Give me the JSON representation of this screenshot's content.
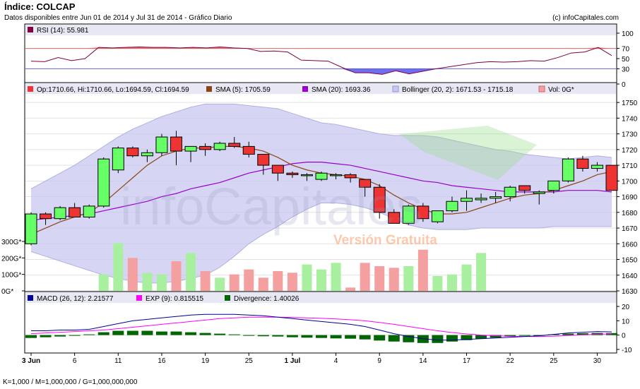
{
  "header": {
    "title": "Índice: COLCAP",
    "subtitle": "Datos disponibles entre Jun 01 de 2014 y Jul 31 de 2014 - Gráfico Diario",
    "copyright": "(c) infoCapitales.com"
  },
  "footer": "K=1,000 / M=1,000,000 / G=1,000,000,000",
  "watermark": {
    "brand": "infoCapitales",
    "version": "Versión Gratuita"
  },
  "colors": {
    "up": "#66ff66",
    "down": "#ee3333",
    "sma5": "#8b4513",
    "sma20": "#9900cc",
    "bollinger": "#c8c8f0",
    "vol_up": "#a8f0a0",
    "vol_down": "#f5a0a0",
    "rsi": "#800040",
    "macd": "#000099",
    "exp": "#ff00ff",
    "divergence": "#006600"
  },
  "chart_data": [
    {
      "panel": "rsi",
      "type": "line",
      "legend": "RSI (14): 55.981",
      "yticks": [
        "100",
        "70",
        "50",
        "30",
        "0"
      ],
      "ylim": [
        0,
        100
      ],
      "levels": [
        70,
        30
      ],
      "values": [
        45,
        44,
        52,
        46,
        50,
        72,
        71,
        72,
        73,
        72,
        72,
        71,
        72,
        71,
        73,
        71,
        70,
        64,
        65,
        63,
        47,
        46,
        45,
        33,
        22,
        22,
        19,
        26,
        20,
        25,
        30,
        34,
        38,
        42,
        44,
        43,
        44,
        46,
        45,
        52,
        61,
        63,
        72,
        56
      ]
    },
    {
      "panel": "price",
      "type": "candlestick",
      "legend": {
        "ohlc": "Op:1710.66, Hi:1710.66, Lo:1694.59, Cl:1694.59",
        "sma5": "SMA (5): 1705.59",
        "sma20": "SMA (20): 1693.36",
        "bollinger": "Bollinger (20, 2): 1671.53 - 1715.18",
        "volume": "Vol: 0G*"
      },
      "yticks": [
        "1750",
        "1740",
        "1730",
        "1720",
        "1710",
        "1700",
        "1690",
        "1680",
        "1670",
        "1660",
        "1650",
        "1640",
        "1630"
      ],
      "ylim": [
        1630,
        1755
      ],
      "volume_ticks": [
        "300G*",
        "200G*",
        "100G*",
        "0G*"
      ],
      "volume_max": 300,
      "xticks": [
        {
          "index": 0,
          "label": "3 Jun"
        },
        {
          "index": 3,
          "label": "6"
        },
        {
          "index": 6,
          "label": "11"
        },
        {
          "index": 9,
          "label": "16"
        },
        {
          "index": 12,
          "label": "19"
        },
        {
          "index": 15,
          "label": "25"
        },
        {
          "index": 18,
          "label": "1 Jul"
        },
        {
          "index": 21,
          "label": "4"
        },
        {
          "index": 24,
          "label": "9"
        },
        {
          "index": 27,
          "label": "14"
        },
        {
          "index": 30,
          "label": "17"
        },
        {
          "index": 33,
          "label": "22"
        },
        {
          "index": 36,
          "label": "25"
        },
        {
          "index": 39,
          "label": "30"
        }
      ],
      "candles": [
        {
          "o": 1660,
          "h": 1680,
          "l": 1659,
          "c": 1679,
          "v": 0
        },
        {
          "o": 1679,
          "h": 1680,
          "l": 1672,
          "c": 1676,
          "v": 0
        },
        {
          "o": 1676,
          "h": 1684,
          "l": 1675,
          "c": 1683,
          "v": 0
        },
        {
          "o": 1683,
          "h": 1686,
          "l": 1677,
          "c": 1677,
          "v": 0
        },
        {
          "o": 1677,
          "h": 1685,
          "l": 1676,
          "c": 1684,
          "v": 0
        },
        {
          "o": 1684,
          "h": 1715,
          "l": 1683,
          "c": 1714,
          "v": 100
        },
        {
          "o": 1707,
          "h": 1722,
          "l": 1705,
          "c": 1721,
          "v": 290
        },
        {
          "o": 1721,
          "h": 1722,
          "l": 1715,
          "c": 1716,
          "v": 200
        },
        {
          "o": 1716,
          "h": 1720,
          "l": 1712,
          "c": 1718,
          "v": 110
        },
        {
          "o": 1718,
          "h": 1730,
          "l": 1716,
          "c": 1728,
          "v": 100
        },
        {
          "o": 1728,
          "h": 1732,
          "l": 1710,
          "c": 1719,
          "v": 180
        },
        {
          "o": 1719,
          "h": 1722,
          "l": 1712,
          "c": 1722,
          "v": 230
        },
        {
          "o": 1722,
          "h": 1724,
          "l": 1716,
          "c": 1720,
          "v": 120
        },
        {
          "o": 1720,
          "h": 1725,
          "l": 1719,
          "c": 1724,
          "v": 80
        },
        {
          "o": 1724,
          "h": 1728,
          "l": 1721,
          "c": 1722,
          "v": 100
        },
        {
          "o": 1722,
          "h": 1725,
          "l": 1715,
          "c": 1717,
          "v": 130
        },
        {
          "o": 1717,
          "h": 1717,
          "l": 1704,
          "c": 1710,
          "v": 80
        },
        {
          "o": 1710,
          "h": 1710,
          "l": 1700,
          "c": 1705,
          "v": 120
        },
        {
          "o": 1705,
          "h": 1706,
          "l": 1702,
          "c": 1704,
          "v": 110
        },
        {
          "o": 1704,
          "h": 1705,
          "l": 1700,
          "c": 1704,
          "v": 160
        },
        {
          "o": 1701,
          "h": 1706,
          "l": 1700,
          "c": 1705,
          "v": 130
        },
        {
          "o": 1704,
          "h": 1705,
          "l": 1701,
          "c": 1704,
          "v": 170
        },
        {
          "o": 1704,
          "h": 1705,
          "l": 1699,
          "c": 1702,
          "v": 20
        },
        {
          "o": 1701,
          "h": 1701,
          "l": 1690,
          "c": 1696,
          "v": 170
        },
        {
          "o": 1696,
          "h": 1698,
          "l": 1676,
          "c": 1680,
          "v": 150
        },
        {
          "o": 1680,
          "h": 1682,
          "l": 1673,
          "c": 1673,
          "v": 140
        },
        {
          "o": 1673,
          "h": 1685,
          "l": 1672,
          "c": 1684,
          "v": 150
        },
        {
          "o": 1684,
          "h": 1686,
          "l": 1674,
          "c": 1676,
          "v": 250
        },
        {
          "o": 1674,
          "h": 1681,
          "l": 1673,
          "c": 1681,
          "v": 90
        },
        {
          "o": 1681,
          "h": 1690,
          "l": 1680,
          "c": 1687,
          "v": 100
        },
        {
          "o": 1687,
          "h": 1694,
          "l": 1681,
          "c": 1689,
          "v": 160
        },
        {
          "o": 1688,
          "h": 1692,
          "l": 1686,
          "c": 1689,
          "v": 230
        },
        {
          "o": 1689,
          "h": 1693,
          "l": 1686,
          "c": 1690,
          "v": 0
        },
        {
          "o": 1690,
          "h": 1697,
          "l": 1687,
          "c": 1696,
          "v": 0
        },
        {
          "o": 1697,
          "h": 1697,
          "l": 1692,
          "c": 1694,
          "v": 0
        },
        {
          "o": 1692,
          "h": 1694,
          "l": 1685,
          "c": 1693,
          "v": 0
        },
        {
          "o": 1694,
          "h": 1700,
          "l": 1692,
          "c": 1700,
          "v": 0
        },
        {
          "o": 1700,
          "h": 1715,
          "l": 1699,
          "c": 1714,
          "v": 0
        },
        {
          "o": 1714,
          "h": 1716,
          "l": 1706,
          "c": 1708,
          "v": 0
        },
        {
          "o": 1708,
          "h": 1712,
          "l": 1706,
          "c": 1710,
          "v": 0
        },
        {
          "o": 1710,
          "h": 1710,
          "l": 1694,
          "c": 1694,
          "v": 0
        }
      ],
      "sma5": [
        1666,
        1670,
        1674,
        1677,
        1680,
        1686,
        1694,
        1702,
        1710,
        1716,
        1719,
        1721,
        1721,
        1722,
        1722,
        1721,
        1719,
        1715,
        1710,
        1707,
        1705,
        1704,
        1703,
        1701,
        1697,
        1691,
        1686,
        1682,
        1679,
        1679,
        1680,
        1683,
        1686,
        1689,
        1691,
        1692,
        1694,
        1697,
        1700,
        1704,
        1706
      ],
      "sma20": [
        1675,
        1676,
        1677,
        1678,
        1679,
        1681,
        1683,
        1685,
        1687,
        1690,
        1692,
        1695,
        1697,
        1699,
        1702,
        1705,
        1707,
        1709,
        1711,
        1712,
        1712,
        1711,
        1710,
        1708,
        1706,
        1704,
        1702,
        1700,
        1699,
        1697,
        1696,
        1695,
        1694,
        1693,
        1693,
        1693,
        1693,
        1694,
        1694,
        1694,
        1693
      ],
      "bollinger_upper": [
        1695,
        1700,
        1705,
        1710,
        1716,
        1722,
        1728,
        1733,
        1737,
        1741,
        1744,
        1747,
        1749,
        1749,
        1749,
        1748,
        1747,
        1746,
        1743,
        1740,
        1737,
        1736,
        1734,
        1732,
        1730,
        1729,
        1729,
        1729,
        1728,
        1726,
        1724,
        1722,
        1720,
        1719,
        1717,
        1716,
        1715,
        1714,
        1715,
        1716,
        1715
      ],
      "bollinger_lower": [
        1655,
        1652,
        1649,
        1646,
        1643,
        1640,
        1638,
        1636,
        1635,
        1635,
        1636,
        1638,
        1640,
        1645,
        1652,
        1660,
        1666,
        1671,
        1677,
        1682,
        1686,
        1686,
        1685,
        1683,
        1680,
        1676,
        1672,
        1670,
        1669,
        1669,
        1669,
        1670,
        1670,
        1670,
        1670,
        1670,
        1671,
        1671,
        1671,
        1671,
        1671
      ]
    },
    {
      "panel": "macd",
      "type": "line",
      "legend": {
        "macd": "MACD (26, 12): 2.21577",
        "exp": "EXP (9): 0.815515",
        "divergence": "Divergence: 1.40026"
      },
      "yticks": [
        "20",
        "10",
        "0",
        "-10"
      ],
      "ylim": [
        -12,
        22
      ],
      "macd": [
        3,
        3,
        3.5,
        3.5,
        4,
        6,
        8,
        10,
        11,
        12,
        13,
        14,
        14.5,
        14.5,
        14.5,
        14,
        13.5,
        12.5,
        11.5,
        10.5,
        9.5,
        8.5,
        7.5,
        6,
        3.5,
        1,
        -1,
        -2.5,
        -3.5,
        -3.5,
        -3,
        -2.5,
        -2,
        -1.5,
        -1,
        -0.5,
        0.5,
        1.5,
        2,
        2.5,
        2.2
      ],
      "exp": [
        1,
        1.5,
        2,
        2.5,
        3,
        3.5,
        4.5,
        5.5,
        6.5,
        7.5,
        8.5,
        9.5,
        10.5,
        11.5,
        12,
        12.5,
        12.5,
        12.5,
        12.3,
        12,
        11.7,
        11.3,
        10.7,
        10,
        8.8,
        7.5,
        6,
        4.5,
        3,
        1.8,
        0.8,
        0,
        -0.5,
        -0.8,
        -1,
        -1,
        -0.8,
        -0.3,
        0.2,
        0.6,
        0.8
      ],
      "divergence": [
        -2,
        -1.5,
        -1,
        -0.5,
        0.5,
        2,
        3,
        3,
        3,
        2.5,
        2.5,
        2,
        1.5,
        1,
        0.5,
        -0.5,
        -0.8,
        -1,
        -1.5,
        -1.8,
        -2,
        -2.3,
        -2.5,
        -3,
        -3.8,
        -4.5,
        -5,
        -5.5,
        -5.5,
        -4.5,
        -3.5,
        -2.5,
        -1.8,
        -1,
        -0.5,
        0,
        0.5,
        1,
        1.3,
        1.5,
        1.4
      ]
    }
  ]
}
